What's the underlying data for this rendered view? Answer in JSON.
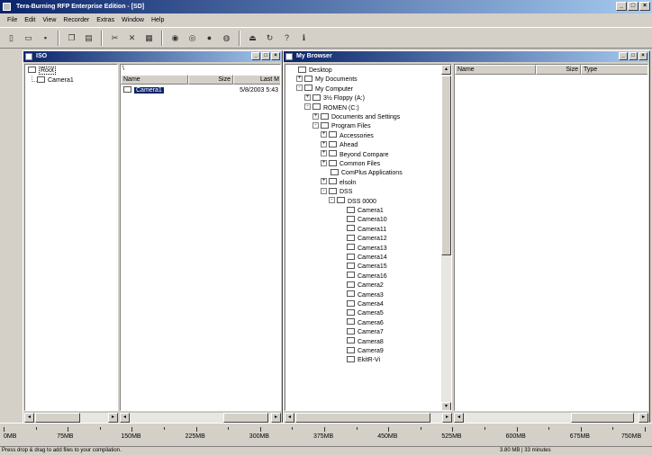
{
  "app": {
    "title": "Tera-Burning RFP Enterprise Edition - [SD]"
  },
  "menu": [
    "File",
    "Edit",
    "View",
    "Recorder",
    "Extras",
    "Window",
    "Help"
  ],
  "toolbar_icons": [
    "new-icon",
    "open-icon",
    "save-icon",
    "sep",
    "copy-icon",
    "paste-icon",
    "sep",
    "cut-icon",
    "delete-icon",
    "properties-icon",
    "sep",
    "burn-icon",
    "erase-icon",
    "record-icon",
    "disc-info-icon",
    "sep",
    "eject-icon",
    "refresh-icon",
    "help-icon",
    "about-icon"
  ],
  "left_window": {
    "title": "ISO",
    "tree_root": "Root",
    "tree_child": "Camera1",
    "col_name": "Name",
    "col_size": "Size",
    "col_last": "Last M",
    "file_name": "Camera1",
    "file_date": "5/8/2003 5:43"
  },
  "right_window": {
    "title": "My Browser",
    "tree": [
      {
        "label": "Desktop",
        "indent": 0,
        "exp": ""
      },
      {
        "label": "My Documents",
        "indent": 1,
        "exp": "+"
      },
      {
        "label": "My Computer",
        "indent": 1,
        "exp": "-"
      },
      {
        "label": "3½ Floppy (A:)",
        "indent": 2,
        "exp": "+"
      },
      {
        "label": "ROMEN (C:)",
        "indent": 2,
        "exp": "-"
      },
      {
        "label": "Documents and Settings",
        "indent": 3,
        "exp": "+"
      },
      {
        "label": "Program Files",
        "indent": 3,
        "exp": "-"
      },
      {
        "label": "Accessories",
        "indent": 4,
        "exp": "+"
      },
      {
        "label": "Ahead",
        "indent": 4,
        "exp": "+"
      },
      {
        "label": "Beyond Compare",
        "indent": 4,
        "exp": "+"
      },
      {
        "label": "Common Files",
        "indent": 4,
        "exp": "+"
      },
      {
        "label": "ComPlus Applications",
        "indent": 4,
        "exp": ""
      },
      {
        "label": "elsoln",
        "indent": 4,
        "exp": "+"
      },
      {
        "label": "DSS",
        "indent": 4,
        "exp": "-"
      },
      {
        "label": "DSS 0000",
        "indent": 5,
        "exp": "-"
      },
      {
        "label": "Camera1",
        "indent": 6,
        "exp": ""
      },
      {
        "label": "Camera10",
        "indent": 6,
        "exp": ""
      },
      {
        "label": "Camera11",
        "indent": 6,
        "exp": ""
      },
      {
        "label": "Camera12",
        "indent": 6,
        "exp": ""
      },
      {
        "label": "Camera13",
        "indent": 6,
        "exp": ""
      },
      {
        "label": "Camera14",
        "indent": 6,
        "exp": ""
      },
      {
        "label": "Camera15",
        "indent": 6,
        "exp": ""
      },
      {
        "label": "Camera16",
        "indent": 6,
        "exp": ""
      },
      {
        "label": "Camera2",
        "indent": 6,
        "exp": ""
      },
      {
        "label": "Camera3",
        "indent": 6,
        "exp": ""
      },
      {
        "label": "Camera4",
        "indent": 6,
        "exp": ""
      },
      {
        "label": "Camera5",
        "indent": 6,
        "exp": ""
      },
      {
        "label": "Camera6",
        "indent": 6,
        "exp": ""
      },
      {
        "label": "Camera7",
        "indent": 6,
        "exp": ""
      },
      {
        "label": "Camera8",
        "indent": 6,
        "exp": ""
      },
      {
        "label": "Camera9",
        "indent": 6,
        "exp": ""
      },
      {
        "label": "EkitR-Vi",
        "indent": 6,
        "exp": ""
      }
    ],
    "col_name": "Name",
    "col_size": "Size",
    "col_type": "Type"
  },
  "ruler": {
    "labels": [
      "0MB",
      "75MB",
      "150MB",
      "225MB",
      "300MB",
      "375MB",
      "450MB",
      "525MB",
      "600MB",
      "675MB",
      "750MB"
    ]
  },
  "status": {
    "left": "Press drop & drag to add files to your compilation.",
    "right": "3.80 MB | 33 minutes"
  }
}
